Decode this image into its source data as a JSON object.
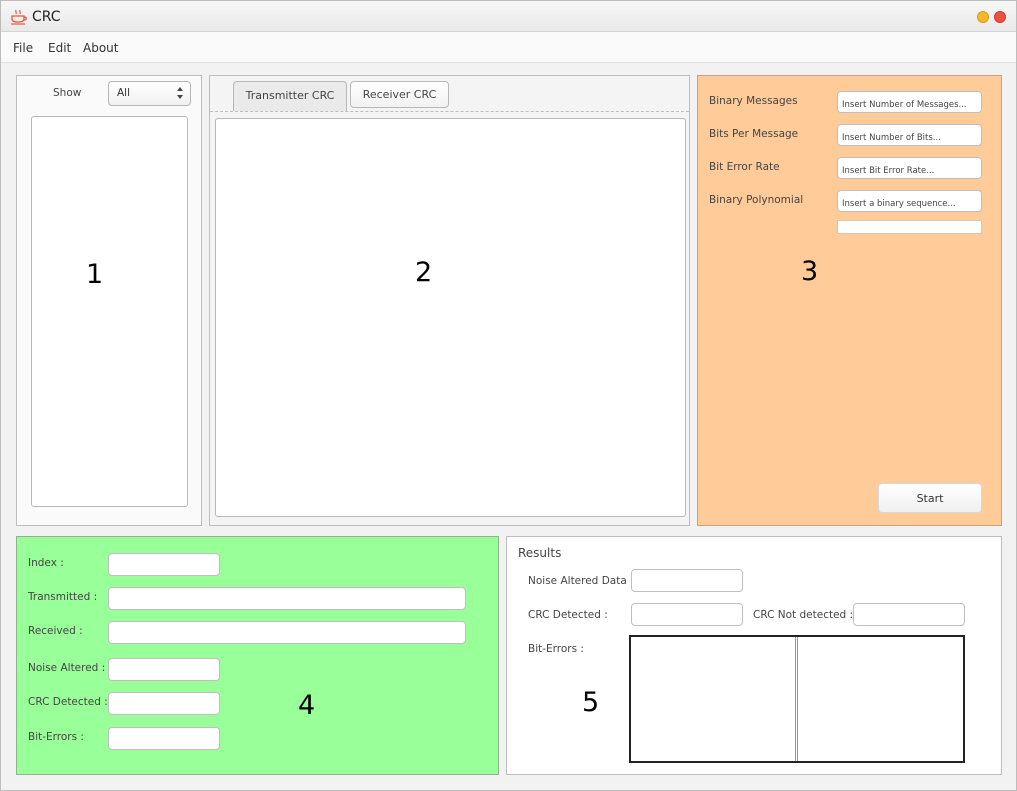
{
  "window": {
    "title": "CRC",
    "colors": {
      "minimize": "#f6b72d",
      "close": "#ee4f40"
    }
  },
  "menubar": {
    "file": "File",
    "edit": "Edit",
    "about": "About"
  },
  "panel1": {
    "show_label": "Show",
    "filter": {
      "value": "All"
    },
    "annotation": "1"
  },
  "panel2": {
    "tabs": [
      {
        "label": "Transmitter CRC",
        "active": true
      },
      {
        "label": "Receiver CRC",
        "active": false
      }
    ],
    "annotation": "2"
  },
  "panel3": {
    "background": "#ffcc99",
    "fields": {
      "binary_messages": {
        "label": "Binary Messages",
        "placeholder": "Insert Number of Messages..."
      },
      "bits_per_message": {
        "label": "Bits Per Message",
        "placeholder": "Insert Number of Bits..."
      },
      "bit_error_rate": {
        "label": "Bit Error Rate",
        "placeholder": "Insert Bit Error Rate..."
      },
      "binary_polynomial": {
        "label": "Binary Polynomial",
        "placeholder": "Insert a binary sequence..."
      }
    },
    "progress": 0,
    "start_label": "Start",
    "annotation": "3"
  },
  "panel4": {
    "background": "#99ff99",
    "index_label": "Index :",
    "transmitted_label": "Transmitted :",
    "received_label": "Received :",
    "noise_altered_label": "Noise Altered :",
    "crc_detected_label": "CRC Detected :",
    "bit_errors_label": "Bit-Errors :",
    "annotation": "4"
  },
  "panel5": {
    "title": "Results",
    "noise_altered_data_label": "Noise Altered Data :",
    "crc_detected_label": "CRC Detected :",
    "crc_not_detected_label": "CRC Not detected :",
    "bit_errors_label": "Bit-Errors :",
    "annotation": "5"
  }
}
